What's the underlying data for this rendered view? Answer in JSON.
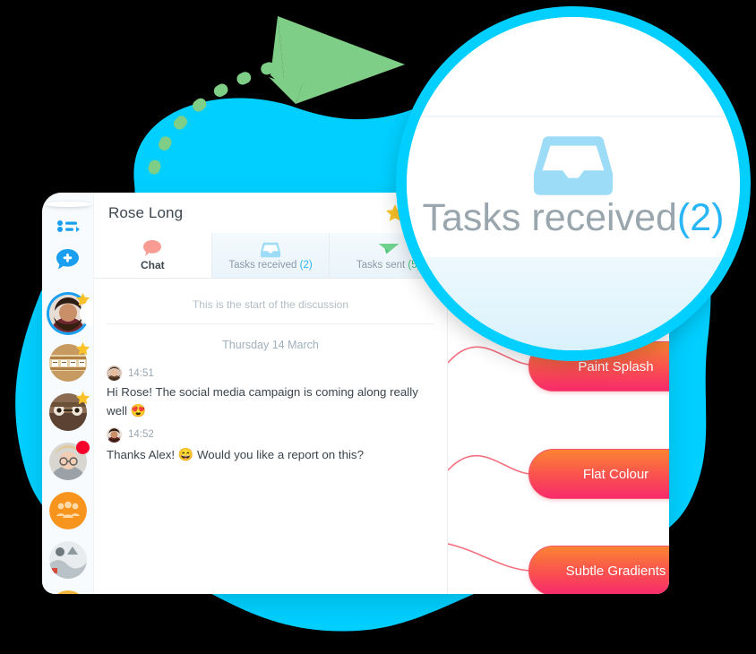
{
  "theme": {
    "cyan": "#00cfff",
    "accent_blue": "#29b6f6",
    "accent_green": "#3cc47c",
    "star_gold": "#f9c228",
    "pill_orange": "#fb8433",
    "pill_pink": "#f72a6b",
    "notify_red": "#f4002a",
    "chat_bubble": "#f79b93"
  },
  "sidebar": {
    "me": {
      "name": "me-avatar"
    },
    "icons": [
      {
        "name": "task-list-icon",
        "label": "Task list"
      },
      {
        "name": "new-chat-icon",
        "label": "New chat"
      }
    ],
    "contacts": [
      {
        "name": "contact-avatar-1",
        "badge": "star",
        "active": true
      },
      {
        "name": "contact-avatar-2",
        "badge": "star",
        "active": false
      },
      {
        "name": "contact-avatar-3",
        "badge": "star",
        "active": false
      },
      {
        "name": "contact-avatar-4",
        "badge": "dot",
        "active": false
      },
      {
        "name": "contact-group-avatar",
        "badge": "none",
        "active": false
      },
      {
        "name": "contact-avatar-6",
        "badge": "none",
        "active": false
      },
      {
        "name": "contact-avatar-7",
        "badge": "none",
        "active": false
      }
    ]
  },
  "header": {
    "title": "Rose Long",
    "star_icon": "star-icon",
    "menu_icon": "more-options-icon"
  },
  "tabs": [
    {
      "label": "Chat",
      "count": "",
      "icon": "chat-bubble-icon",
      "active": true
    },
    {
      "label": "Tasks received",
      "count": "(2)",
      "icon": "inbox-tray-icon",
      "active": false
    },
    {
      "label": "Tasks sent",
      "count": "(5)",
      "icon": "paper-plane-icon",
      "active": false
    }
  ],
  "conversation": {
    "start_note": "This is the start of the discussion",
    "date_separator": "Thursday 14 March",
    "messages": [
      {
        "time": "14:51",
        "text": "Hi Rose! The social media campaign is coming along really well ",
        "emoji": "😍",
        "avatar": "message-avatar-alex"
      },
      {
        "time": "14:52",
        "text_before": "Thanks Alex! ",
        "emoji": "😄",
        "text_after": " Would you like a report on this?",
        "avatar": "message-avatar-rose"
      }
    ]
  },
  "mindmap": {
    "nodes": [
      {
        "label": "Paint Splash"
      },
      {
        "label": "Flat Colour"
      },
      {
        "label": "Subtle Gradients"
      }
    ]
  },
  "magnifier": {
    "label": "Tasks received",
    "count": "(2)",
    "icon": "inbox-tray-icon"
  }
}
